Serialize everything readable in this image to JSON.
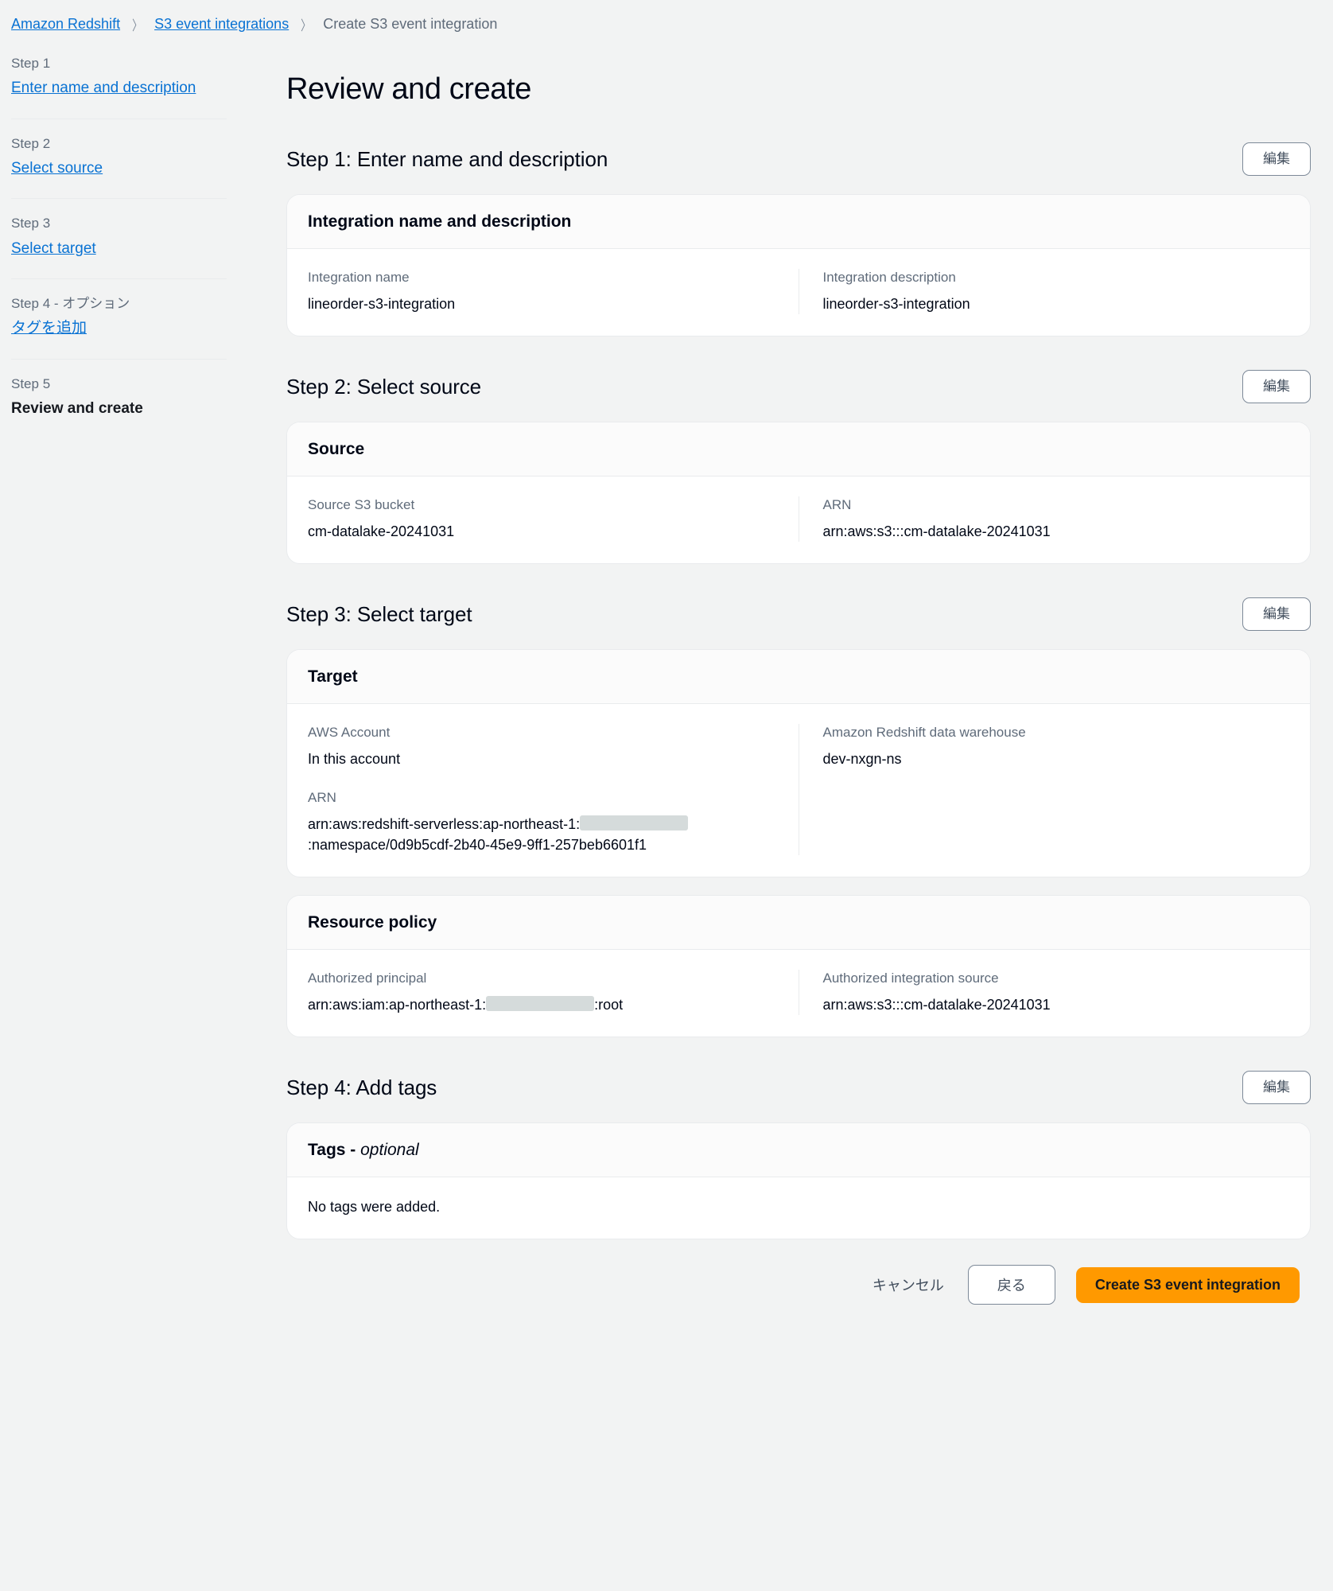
{
  "breadcrumb": {
    "items": [
      {
        "label": "Amazon Redshift",
        "link": true
      },
      {
        "label": "S3 event integrations",
        "link": true
      },
      {
        "label": "Create S3 event integration",
        "link": false
      }
    ],
    "separator": "〉"
  },
  "sidebar": {
    "steps": [
      {
        "number": "Step 1",
        "label": "Enter name and description",
        "active": false
      },
      {
        "number": "Step 2",
        "label": "Select source",
        "active": false
      },
      {
        "number": "Step 3",
        "label": "Select target",
        "active": false
      },
      {
        "number": "Step 4 - オプション",
        "label": "タグを追加",
        "active": false
      },
      {
        "number": "Step 5",
        "label": "Review and create",
        "active": true
      }
    ]
  },
  "main": {
    "title": "Review and create",
    "edit_label": "編集",
    "step1": {
      "heading": "Step 1: Enter name and description",
      "card_title": "Integration name and description",
      "left": {
        "label": "Integration name",
        "value": "lineorder-s3-integration"
      },
      "right": {
        "label": "Integration description",
        "value": "lineorder-s3-integration"
      }
    },
    "step2": {
      "heading": "Step 2: Select source",
      "card_title": "Source",
      "left": {
        "label": "Source S3 bucket",
        "value": "cm-datalake-20241031"
      },
      "right": {
        "label": "ARN",
        "value": "arn:aws:s3:::cm-datalake-20241031"
      }
    },
    "step3": {
      "heading": "Step 3: Select target",
      "target_card_title": "Target",
      "account": {
        "label": "AWS Account",
        "value": "In this account"
      },
      "arn": {
        "label": "ARN",
        "value_prefix": "arn:aws:redshift-serverless:ap-northeast-1:",
        "value_suffix": ":namespace/0d9b5cdf-2b40-45e9-9ff1-257beb6601f1"
      },
      "warehouse": {
        "label": "Amazon Redshift data warehouse",
        "value": "dev-nxgn-ns"
      },
      "policy_card_title": "Resource policy",
      "principal": {
        "label": "Authorized principal",
        "value_prefix": "arn:aws:iam:ap-northeast-1:",
        "value_suffix": ":root"
      },
      "integration_source": {
        "label": "Authorized integration source",
        "value": "arn:aws:s3:::cm-datalake-20241031"
      }
    },
    "step4": {
      "heading": "Step 4: Add tags",
      "card_title_bold": "Tags - ",
      "card_title_italic": "optional",
      "empty_text": "No tags were added."
    }
  },
  "footer": {
    "cancel_label": "キャンセル",
    "back_label": "戻る",
    "create_label": "Create S3 event integration"
  },
  "colors": {
    "link": "#0972d3",
    "primary": "#ff9900",
    "background": "#f2f3f3",
    "card": "#ffffff",
    "border": "#e9ebed",
    "muted_text": "#5f6b7a"
  }
}
